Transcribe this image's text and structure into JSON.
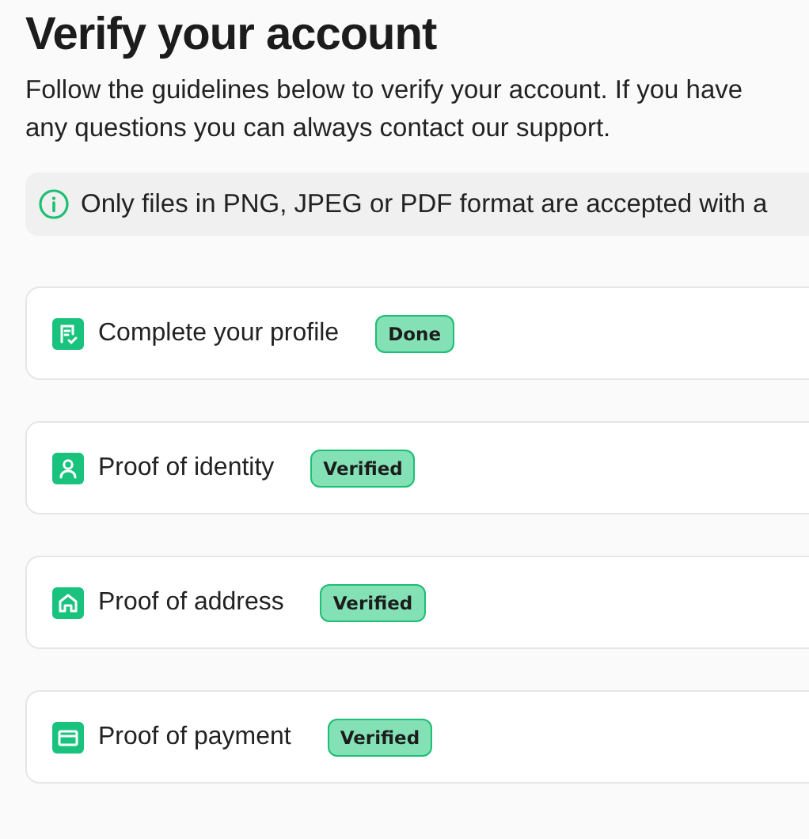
{
  "title": "Verify your account",
  "intro": "Follow the guidelines below to verify your account. If you have any questions you can always contact our support.",
  "notice": "Only files in PNG, JPEG or PDF format are accepted with a",
  "steps": [
    {
      "kind": "profile",
      "label": "Complete your profile",
      "badge": "Done"
    },
    {
      "kind": "identity",
      "label": "Proof of identity",
      "badge": "Verified"
    },
    {
      "kind": "address",
      "label": "Proof of address",
      "badge": "Verified"
    },
    {
      "kind": "payment",
      "label": "Proof of payment",
      "badge": "Verified"
    }
  ]
}
